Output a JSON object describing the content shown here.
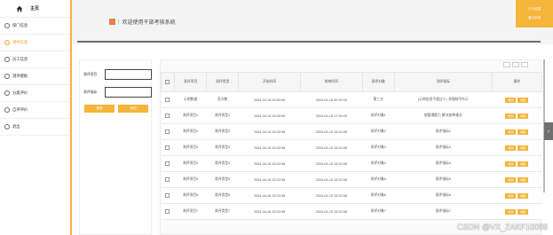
{
  "sidebar": {
    "home_label": "主页",
    "items": [
      {
        "label": "部门信息",
        "active": false
      },
      {
        "label": "领导信息",
        "active": true
      },
      {
        "label": "员工信息",
        "active": false
      },
      {
        "label": "测评模板",
        "active": false
      },
      {
        "label": "分类评价",
        "active": false
      },
      {
        "label": "自评评价",
        "active": false
      },
      {
        "label": "退出",
        "active": false
      }
    ]
  },
  "header": {
    "title": "欢迎使用干部考核系统",
    "corner_top": "个人信息",
    "corner_bottom": "退出系统"
  },
  "search": {
    "field1_label": "测评项目",
    "field2_label": "测评指标",
    "search_button": "搜索",
    "add_button": "添加"
  },
  "table": {
    "headers": [
      "测评项目",
      "测评类型",
      "开始时间",
      "结束时间",
      "测评对象",
      "测评指标",
      "操作"
    ],
    "rows": [
      [
        "示例数据",
        "官方数",
        "2024-04-15 00:00:00",
        "2024-04-15 00:00:00",
        "第三方",
        "(示例信息不超过十) 非强制不作示",
        "编辑/删除"
      ],
      [
        "测评项目1",
        "测评类型1",
        "2024-04-15 15:00:00",
        "2024-04-15 17:00:00",
        "测评对象1",
        "按管理能力 解决各种难点",
        "编辑/删除"
      ],
      [
        "测评项目2",
        "测评类型2",
        "2024-04-15 15:22:58",
        "2024-04-15 15:22:58",
        "测评对象2",
        "测评指标2",
        "编辑/删除"
      ],
      [
        "测评项目3",
        "测评类型3",
        "2024-04-15 15:22:58",
        "2024-04-15 15:22:58",
        "测评对象3",
        "测评指标3",
        "编辑/删除"
      ],
      [
        "测评项目4",
        "测评类型4",
        "2024-04-15 15:22:58",
        "2024-04-15 15:22:58",
        "测评对象4",
        "测评指标4",
        "编辑/删除"
      ],
      [
        "测评项目5",
        "测评类型5",
        "2024-04-15 15:22:58",
        "2024-04-15 15:22:58",
        "测评对象5",
        "测评指标5",
        "编辑/删除"
      ],
      [
        "测评项目6",
        "测评类型6",
        "2024-04-15 15:22:58",
        "2024-04-15 15:22:58",
        "测评对象6",
        "测评指标6",
        "编辑/删除"
      ],
      [
        "测评项目7",
        "测评类型7",
        "2024-04-15 15:22:58",
        "2024-04-15 15:22:58",
        "测评对象7",
        "测评指标7",
        "编辑/删除"
      ]
    ],
    "edit_label": "修改",
    "delete_label": "删除"
  },
  "watermark": "CSDN @VX_ZAKF10088",
  "colors": {
    "accent": "#f5b53b",
    "active_text": "#e8a21c"
  }
}
